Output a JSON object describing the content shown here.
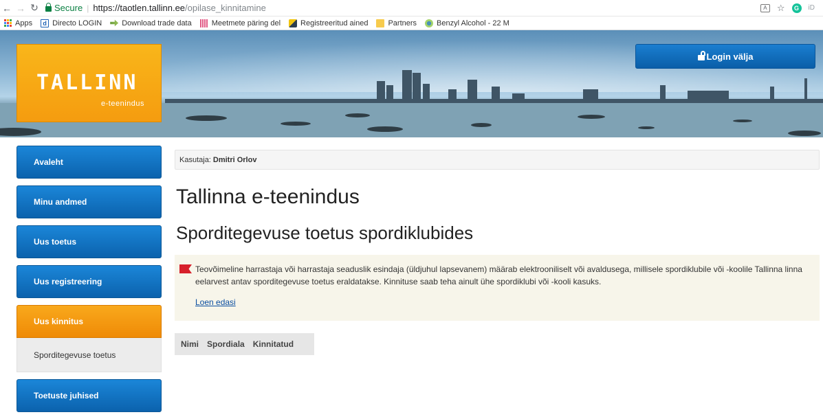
{
  "browser": {
    "secure_label": "Secure",
    "url_host": "https://taotlen.tallinn.ee",
    "url_path": "/opilase_kinnitamine",
    "bookmarks": [
      {
        "label": "Apps",
        "icon": "apps-grid-icon"
      },
      {
        "label": "Directo LOGIN",
        "icon": "directo-icon"
      },
      {
        "label": "Download trade data",
        "icon": "arrow-icon"
      },
      {
        "label": "Meetmete päring del",
        "icon": "chart-icon"
      },
      {
        "label": "Registreeritud ained",
        "icon": "registry-icon"
      },
      {
        "label": "Partners",
        "icon": "folder-icon"
      },
      {
        "label": "Benzyl Alcohol - 22 M",
        "icon": "benzyl-icon"
      }
    ]
  },
  "header": {
    "logo_text": "TALLINN",
    "logo_sub": "e-teenindus",
    "login_label": "Login välja",
    "brand_color": "#f7a214",
    "accent_color": "#0d6bbd"
  },
  "sidebar": {
    "items": [
      {
        "label": "Avaleht"
      },
      {
        "label": "Minu andmed"
      },
      {
        "label": "Uus toetus"
      },
      {
        "label": "Uus registreering"
      },
      {
        "label": "Uus kinnitus",
        "active": true
      },
      {
        "label": "Toetuste juhised"
      }
    ],
    "subitem": "Sporditegevuse toetus"
  },
  "main": {
    "user_label": "Kasutaja:",
    "user_name": "Dmitri Orlov",
    "title": "Tallinna e-teenindus",
    "subtitle": "Sporditegevuse toetus spordiklubides",
    "info_text": "Teovõimeline harrastaja või harrastaja seaduslik esindaja (üldjuhul lapsevanem) määrab elektrooniliselt või avaldusega, millisele spordiklubile või -koolile Tallinna linna eelarvest antav sporditegevuse toetus eraldatakse. Kinnituse saab teha ainult ühe spordiklubi või -kooli kasuks.",
    "read_more": "Loen edasi",
    "table_headers": [
      "Nimi",
      "Spordiala",
      "Kinnitatud"
    ]
  }
}
